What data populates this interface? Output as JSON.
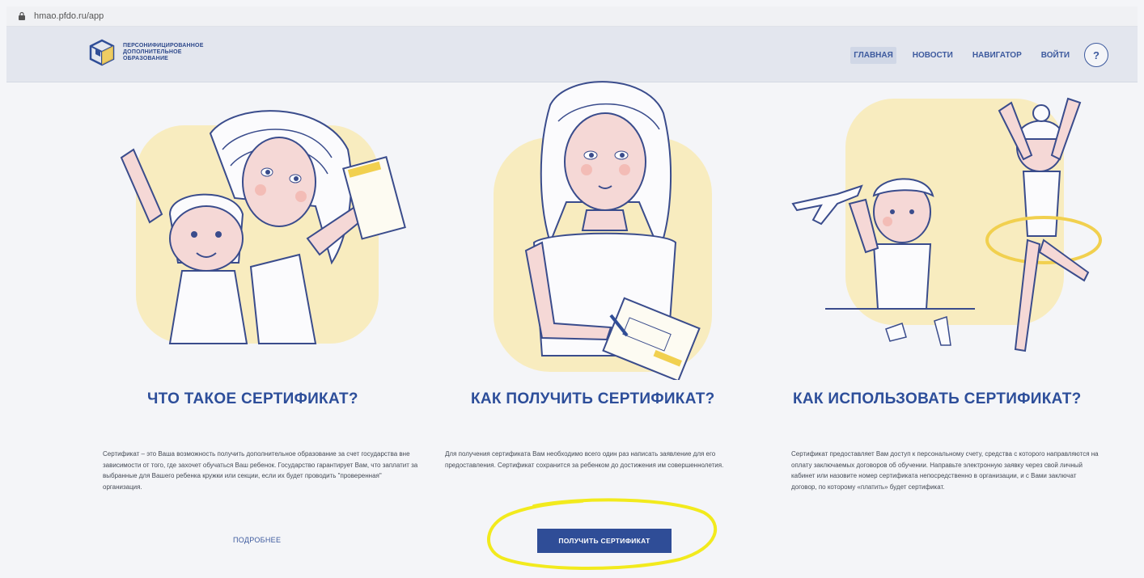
{
  "browser": {
    "url": "hmao.pfdo.ru/app"
  },
  "header": {
    "logo_text": "ПЕРСОНИФИЦИРОВАННОЕ ДОПОЛНИТЕЛЬНОЕ ОБРАЗОВАНИЕ",
    "nav": [
      {
        "label": "ГЛАВНАЯ",
        "active": true
      },
      {
        "label": "НОВОСТИ",
        "active": false
      },
      {
        "label": "НАВИГАТОР",
        "active": false
      },
      {
        "label": "ВОЙТИ",
        "active": false
      }
    ],
    "help_label": "?"
  },
  "sections": [
    {
      "title": "ЧТО ТАКОЕ СЕРТИФИКАТ?",
      "text": "Сертификат – это Ваша возможность получить дополнительное образование за счет государства вне зависимости от того, где захочет обучаться Ваш ребенок. Государство гарантирует Вам, что заплатит за выбранные для Вашего ребенка кружки или секции, если их будет проводить \"проверенная\" организация.",
      "link": "ПОДРОБНЕЕ"
    },
    {
      "title": "КАК ПОЛУЧИТЬ СЕРТИФИКАТ?",
      "text": "Для получения сертификата Вам необходимо всего один раз написать заявление для его предоставления. Сертификат сохранится за ребенком до достижения им совершеннолетия.",
      "button": "ПОЛУЧИТЬ СЕРТИФИКАТ"
    },
    {
      "title": "КАК ИСПОЛЬЗОВАТЬ СЕРТИФИКАТ?",
      "text": "Сертификат предоставляет Вам доступ к персональному счету, средства с которого направляются на оплату заключаемых договоров об обучении. Направьте электронную заявку через свой личный кабинет или назовите номер сертификата непосредственно в организации, и с Вами заключат договор, по которому «платить» будет сертификат."
    }
  ],
  "colors": {
    "brand_blue": "#2f4d97",
    "accent_yellow": "#f7e9b4",
    "highlight_marker": "#f2ea1d"
  },
  "icons": [
    "lock-icon",
    "logo-cube-icon",
    "help-icon"
  ]
}
